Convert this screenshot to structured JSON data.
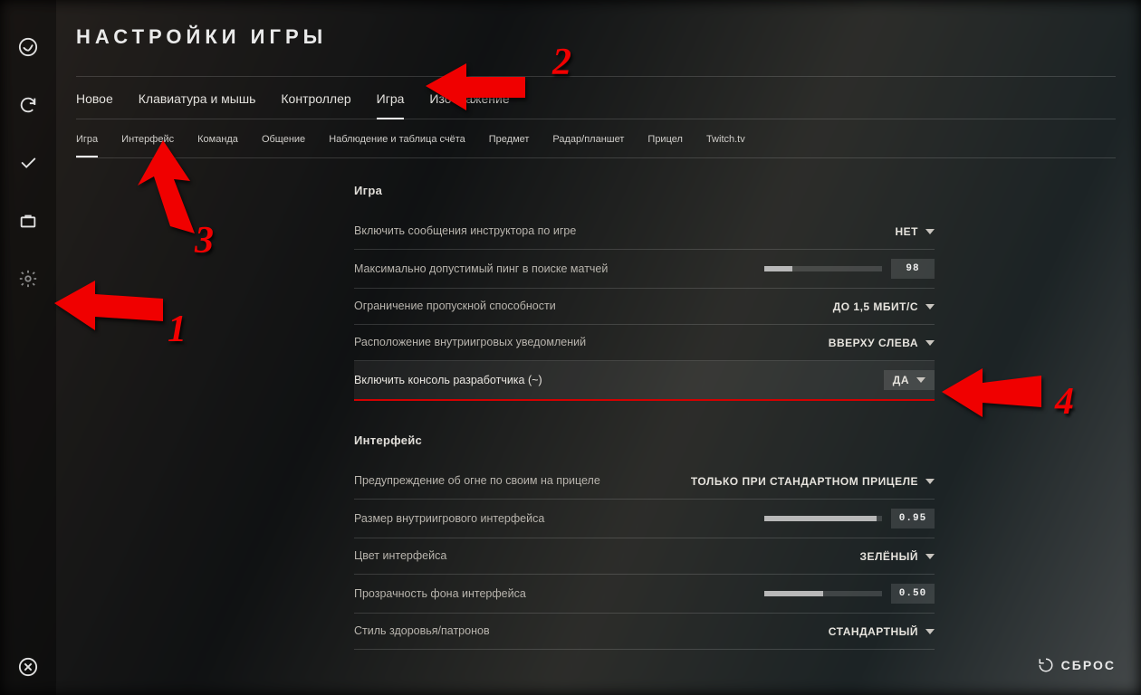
{
  "header": {
    "title": "НАСТРОЙКИ ИГРЫ"
  },
  "tabs_primary": {
    "items": [
      "Новое",
      "Клавиатура и мышь",
      "Контроллер",
      "Игра",
      "Изображение"
    ],
    "active": 3
  },
  "tabs_secondary": {
    "items": [
      "Игра",
      "Интерфейс",
      "Команда",
      "Общение",
      "Наблюдение и таблица счёта",
      "Предмет",
      "Радар/планшет",
      "Прицел",
      "Twitch.tv"
    ],
    "active": 0
  },
  "sections": {
    "game": {
      "heading": "Игра",
      "rows": {
        "instructor": {
          "label": "Включить сообщения инструктора по игре",
          "value": "НЕТ"
        },
        "ping": {
          "label": "Максимально допустимый пинг в поиске матчей",
          "value": "98",
          "slider_pct": 24
        },
        "bandwidth": {
          "label": "Ограничение пропускной способности",
          "value": "ДО 1,5 МБИТ/С"
        },
        "notif_pos": {
          "label": "Расположение внутриигровых уведомлений",
          "value": "ВВЕРХУ СЛЕВА"
        },
        "devconsole": {
          "label": "Включить консоль разработчика (~)",
          "value": "ДА"
        }
      }
    },
    "interface": {
      "heading": "Интерфейс",
      "rows": {
        "ff_warn": {
          "label": "Предупреждение об огне по своим на прицеле",
          "value": "ТОЛЬКО ПРИ СТАНДАРТНОМ ПРИЦЕЛЕ"
        },
        "hud_scale": {
          "label": "Размер внутриигрового интерфейса",
          "value": "0.95",
          "slider_pct": 95
        },
        "hud_color": {
          "label": "Цвет интерфейса",
          "value": "ЗЕЛЁНЫЙ"
        },
        "hud_alpha": {
          "label": "Прозрачность фона интерфейса",
          "value": "0.50",
          "slider_pct": 50
        },
        "hp_style": {
          "label": "Стиль здоровья/патронов",
          "value": "СТАНДАРТНЫЙ"
        }
      }
    }
  },
  "footer": {
    "reset": "СБРОС"
  },
  "annotations": {
    "n1": "1",
    "n2": "2",
    "n3": "3",
    "n4": "4"
  }
}
